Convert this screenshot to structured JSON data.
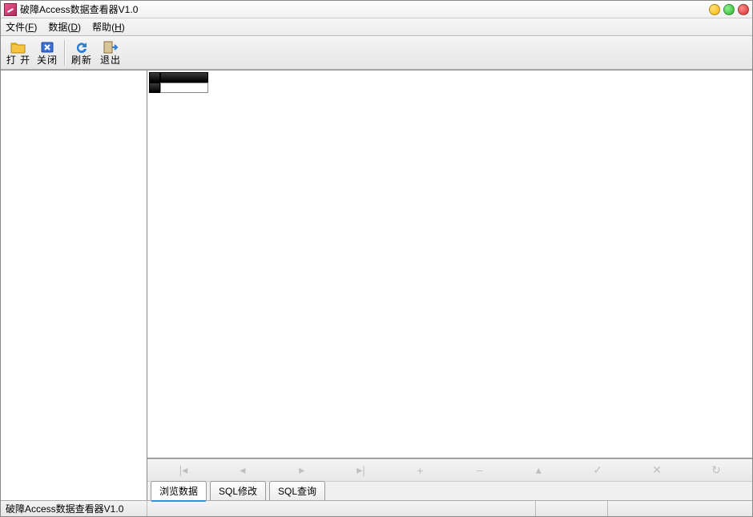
{
  "title": "破障Access数据查看器V1.0",
  "menus": {
    "file": {
      "label": "文件",
      "key": "F"
    },
    "data": {
      "label": "数据",
      "key": "D"
    },
    "help": {
      "label": "帮助",
      "key": "H"
    }
  },
  "toolbar": {
    "open": "打 开",
    "close": "关闭",
    "refresh": "刷新",
    "exit": "退出"
  },
  "nav": {
    "first": "|◂",
    "prev": "◂",
    "next": "▸",
    "last": "▸|",
    "add": "+",
    "remove": "−",
    "edit": "▴",
    "post": "✓",
    "cancel": "✕",
    "refresh": "↻"
  },
  "tabs": {
    "browse": "浏览数据",
    "sql_edit": "SQL修改",
    "sql_query": "SQL查询"
  },
  "statusbar": {
    "text": "破障Access数据查看器V1.0"
  }
}
